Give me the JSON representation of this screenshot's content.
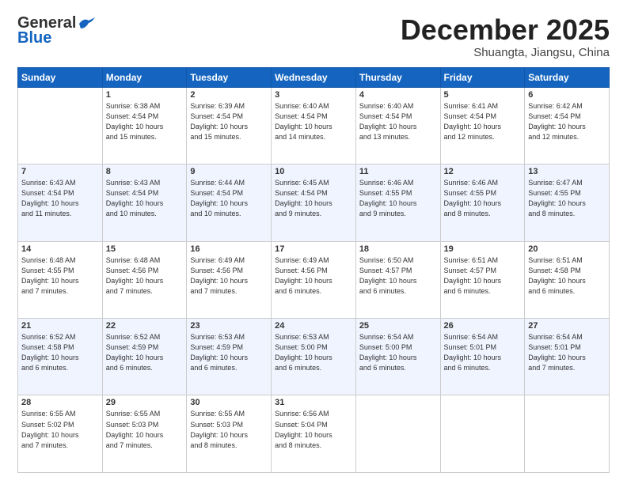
{
  "logo": {
    "general": "General",
    "blue": "Blue"
  },
  "header": {
    "month": "December 2025",
    "location": "Shuangta, Jiangsu, China"
  },
  "weekdays": [
    "Sunday",
    "Monday",
    "Tuesday",
    "Wednesday",
    "Thursday",
    "Friday",
    "Saturday"
  ],
  "weeks": [
    [
      {
        "day": "",
        "info": ""
      },
      {
        "day": "1",
        "info": "Sunrise: 6:38 AM\nSunset: 4:54 PM\nDaylight: 10 hours\nand 15 minutes."
      },
      {
        "day": "2",
        "info": "Sunrise: 6:39 AM\nSunset: 4:54 PM\nDaylight: 10 hours\nand 15 minutes."
      },
      {
        "day": "3",
        "info": "Sunrise: 6:40 AM\nSunset: 4:54 PM\nDaylight: 10 hours\nand 14 minutes."
      },
      {
        "day": "4",
        "info": "Sunrise: 6:40 AM\nSunset: 4:54 PM\nDaylight: 10 hours\nand 13 minutes."
      },
      {
        "day": "5",
        "info": "Sunrise: 6:41 AM\nSunset: 4:54 PM\nDaylight: 10 hours\nand 12 minutes."
      },
      {
        "day": "6",
        "info": "Sunrise: 6:42 AM\nSunset: 4:54 PM\nDaylight: 10 hours\nand 12 minutes."
      }
    ],
    [
      {
        "day": "7",
        "info": "Sunrise: 6:43 AM\nSunset: 4:54 PM\nDaylight: 10 hours\nand 11 minutes."
      },
      {
        "day": "8",
        "info": "Sunrise: 6:43 AM\nSunset: 4:54 PM\nDaylight: 10 hours\nand 10 minutes."
      },
      {
        "day": "9",
        "info": "Sunrise: 6:44 AM\nSunset: 4:54 PM\nDaylight: 10 hours\nand 10 minutes."
      },
      {
        "day": "10",
        "info": "Sunrise: 6:45 AM\nSunset: 4:54 PM\nDaylight: 10 hours\nand 9 minutes."
      },
      {
        "day": "11",
        "info": "Sunrise: 6:46 AM\nSunset: 4:55 PM\nDaylight: 10 hours\nand 9 minutes."
      },
      {
        "day": "12",
        "info": "Sunrise: 6:46 AM\nSunset: 4:55 PM\nDaylight: 10 hours\nand 8 minutes."
      },
      {
        "day": "13",
        "info": "Sunrise: 6:47 AM\nSunset: 4:55 PM\nDaylight: 10 hours\nand 8 minutes."
      }
    ],
    [
      {
        "day": "14",
        "info": "Sunrise: 6:48 AM\nSunset: 4:55 PM\nDaylight: 10 hours\nand 7 minutes."
      },
      {
        "day": "15",
        "info": "Sunrise: 6:48 AM\nSunset: 4:56 PM\nDaylight: 10 hours\nand 7 minutes."
      },
      {
        "day": "16",
        "info": "Sunrise: 6:49 AM\nSunset: 4:56 PM\nDaylight: 10 hours\nand 7 minutes."
      },
      {
        "day": "17",
        "info": "Sunrise: 6:49 AM\nSunset: 4:56 PM\nDaylight: 10 hours\nand 6 minutes."
      },
      {
        "day": "18",
        "info": "Sunrise: 6:50 AM\nSunset: 4:57 PM\nDaylight: 10 hours\nand 6 minutes."
      },
      {
        "day": "19",
        "info": "Sunrise: 6:51 AM\nSunset: 4:57 PM\nDaylight: 10 hours\nand 6 minutes."
      },
      {
        "day": "20",
        "info": "Sunrise: 6:51 AM\nSunset: 4:58 PM\nDaylight: 10 hours\nand 6 minutes."
      }
    ],
    [
      {
        "day": "21",
        "info": "Sunrise: 6:52 AM\nSunset: 4:58 PM\nDaylight: 10 hours\nand 6 minutes."
      },
      {
        "day": "22",
        "info": "Sunrise: 6:52 AM\nSunset: 4:59 PM\nDaylight: 10 hours\nand 6 minutes."
      },
      {
        "day": "23",
        "info": "Sunrise: 6:53 AM\nSunset: 4:59 PM\nDaylight: 10 hours\nand 6 minutes."
      },
      {
        "day": "24",
        "info": "Sunrise: 6:53 AM\nSunset: 5:00 PM\nDaylight: 10 hours\nand 6 minutes."
      },
      {
        "day": "25",
        "info": "Sunrise: 6:54 AM\nSunset: 5:00 PM\nDaylight: 10 hours\nand 6 minutes."
      },
      {
        "day": "26",
        "info": "Sunrise: 6:54 AM\nSunset: 5:01 PM\nDaylight: 10 hours\nand 6 minutes."
      },
      {
        "day": "27",
        "info": "Sunrise: 6:54 AM\nSunset: 5:01 PM\nDaylight: 10 hours\nand 7 minutes."
      }
    ],
    [
      {
        "day": "28",
        "info": "Sunrise: 6:55 AM\nSunset: 5:02 PM\nDaylight: 10 hours\nand 7 minutes."
      },
      {
        "day": "29",
        "info": "Sunrise: 6:55 AM\nSunset: 5:03 PM\nDaylight: 10 hours\nand 7 minutes."
      },
      {
        "day": "30",
        "info": "Sunrise: 6:55 AM\nSunset: 5:03 PM\nDaylight: 10 hours\nand 8 minutes."
      },
      {
        "day": "31",
        "info": "Sunrise: 6:56 AM\nSunset: 5:04 PM\nDaylight: 10 hours\nand 8 minutes."
      },
      {
        "day": "",
        "info": ""
      },
      {
        "day": "",
        "info": ""
      },
      {
        "day": "",
        "info": ""
      }
    ]
  ]
}
